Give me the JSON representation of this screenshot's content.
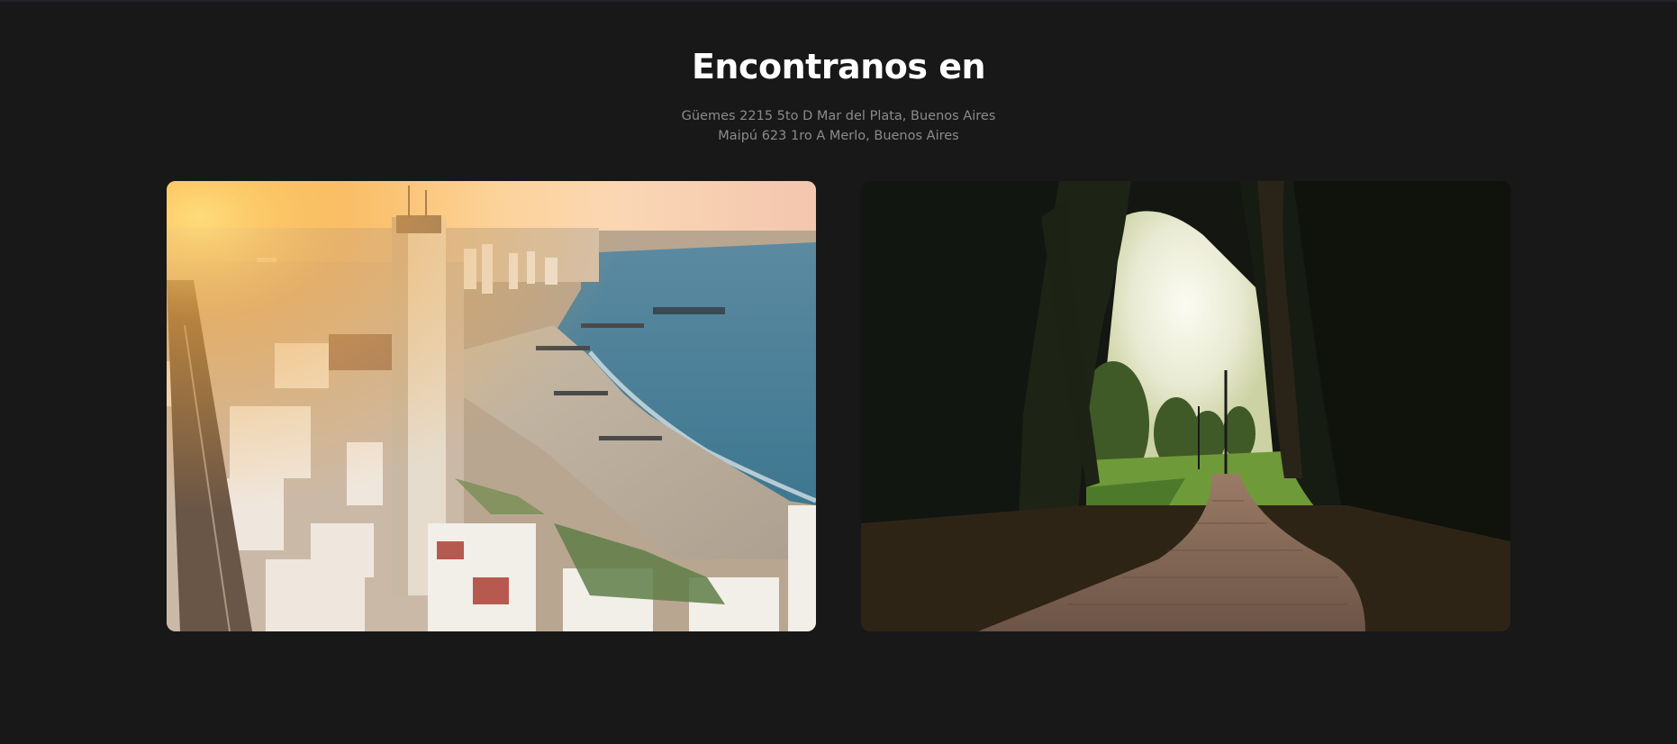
{
  "section": {
    "title": "Encontranos en",
    "addresses": [
      "Güemes 2215 5to D Mar del Plata, Buenos Aires",
      "Maipú 623 1ro A Merlo, Buenos Aires"
    ]
  },
  "images": [
    {
      "subject": "aerial coastal city at sunset"
    },
    {
      "subject": "park path under dark trees"
    }
  ],
  "colors": {
    "background": "#181818",
    "title": "#ffffff",
    "subtitle": "#8b8b8b"
  }
}
